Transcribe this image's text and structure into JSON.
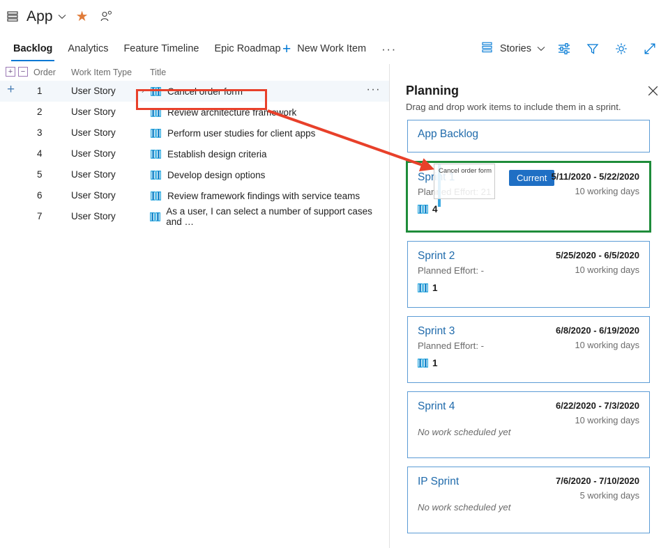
{
  "topbar": {
    "project_icon": "stacked-rows-icon",
    "app_name": "App",
    "chevron": "∨",
    "star": "★",
    "people_icon": "people-add-icon"
  },
  "tabs": [
    {
      "label": "Backlog",
      "active": true
    },
    {
      "label": "Analytics",
      "active": false
    },
    {
      "label": "Feature Timeline",
      "active": false
    },
    {
      "label": "Epic Roadmap",
      "active": false
    }
  ],
  "toolbar": {
    "new_work_item": "New Work Item",
    "plus": "+",
    "more": "···",
    "stories_label": "Stories",
    "stories_chevron": "∨",
    "column_options_icon": "column-options-icon",
    "filter_icon": "filter-icon",
    "settings_icon": "gear-icon",
    "fullscreen_icon": "expand-icon"
  },
  "grid": {
    "expand_all": "+",
    "collapse_all": "−",
    "columns": [
      "Order",
      "Work Item Type",
      "Title"
    ],
    "rows": [
      {
        "order": "1",
        "type": "User Story",
        "title": "Cancel order form",
        "selected": true,
        "expander": "›"
      },
      {
        "order": "2",
        "type": "User Story",
        "title": "Review architecture framework",
        "selected": false,
        "expander": ""
      },
      {
        "order": "3",
        "type": "User Story",
        "title": "Perform user studies for client apps",
        "selected": false,
        "expander": ""
      },
      {
        "order": "4",
        "type": "User Story",
        "title": "Establish design criteria",
        "selected": false,
        "expander": ""
      },
      {
        "order": "5",
        "type": "User Story",
        "title": "Develop design options",
        "selected": false,
        "expander": ""
      },
      {
        "order": "6",
        "type": "User Story",
        "title": "Review framework findings with service teams",
        "selected": false,
        "expander": ""
      },
      {
        "order": "7",
        "type": "User Story",
        "title": "As a user, I can select a number of support cases and …",
        "selected": false,
        "expander": ""
      }
    ],
    "row_menu": "···",
    "add_row_glyph": "+"
  },
  "panel": {
    "title": "Planning",
    "subtitle": "Drag and drop work items to include them in a sprint.",
    "close_icon": "close-icon",
    "backlog_card": {
      "title": "App Backlog"
    },
    "sprints": [
      {
        "name": "Sprint 1",
        "effort": "Planned Effort: 21",
        "badge": "Current",
        "dates": "5/11/2020 - 5/22/2020",
        "days": "10 working days",
        "count": "4",
        "empty_text": "",
        "highlighted": true
      },
      {
        "name": "Sprint 2",
        "effort": "Planned Effort: -",
        "badge": "",
        "dates": "5/25/2020 - 6/5/2020",
        "days": "10 working days",
        "count": "1",
        "empty_text": "",
        "highlighted": false
      },
      {
        "name": "Sprint 3",
        "effort": "Planned Effort: -",
        "badge": "",
        "dates": "6/8/2020 - 6/19/2020",
        "days": "10 working days",
        "count": "1",
        "empty_text": "",
        "highlighted": false
      },
      {
        "name": "Sprint 4",
        "effort": "",
        "badge": "",
        "dates": "6/22/2020 - 7/3/2020",
        "days": "10 working days",
        "count": "",
        "empty_text": "No work scheduled yet",
        "highlighted": false
      },
      {
        "name": "IP Sprint",
        "effort": "",
        "badge": "",
        "dates": "7/6/2020 - 7/10/2020",
        "days": "5 working days",
        "count": "",
        "empty_text": "No work scheduled yet",
        "highlighted": false
      }
    ]
  },
  "drag": {
    "ghost_label": "Cancel order form",
    "drop_indicator": "drop-indicator"
  },
  "annotations": {
    "highlight_box_color": "#e8402a",
    "arrow_color": "#e8402a",
    "sprint_highlight_color": "#1e8c3a"
  }
}
